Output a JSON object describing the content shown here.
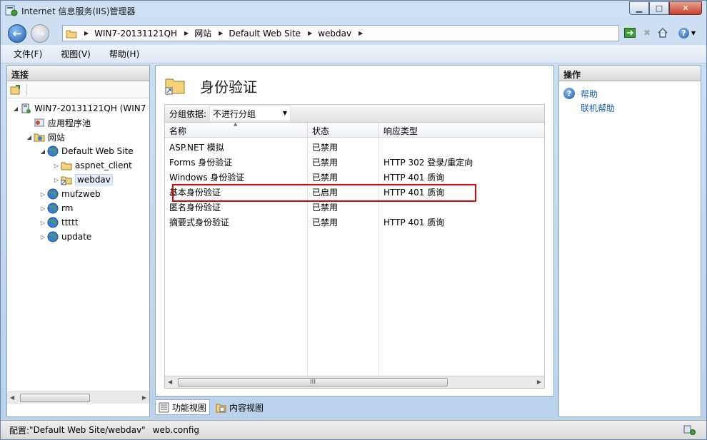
{
  "window": {
    "title": "Internet 信息服务(IIS)管理器",
    "controls": {
      "minimize": "▁",
      "maximize": "□",
      "close": "✕"
    }
  },
  "address": {
    "crumbs": [
      "WIN7-20131121QH",
      "网站",
      "Default Web Site",
      "webdav"
    ]
  },
  "menu": [
    "文件(F)",
    "视图(V)",
    "帮助(H)"
  ],
  "connections": {
    "header": "连接",
    "tree": [
      {
        "label": "WIN7-20131121QH (WIN7",
        "icon": "server-icon",
        "expander": "◢"
      },
      {
        "label": "应用程序池",
        "icon": "app-pool-icon",
        "expander": ""
      },
      {
        "label": "网站",
        "icon": "sites-folder-icon",
        "expander": "◢"
      },
      {
        "label": "Default Web Site",
        "icon": "globe-icon",
        "expander": "◢"
      },
      {
        "label": "aspnet_client",
        "icon": "folder-icon",
        "expander": "▷"
      },
      {
        "label": "webdav",
        "icon": "virtual-folder-icon",
        "expander": "▷",
        "selected": true
      },
      {
        "label": "mufzweb",
        "icon": "globe-icon",
        "expander": "▷"
      },
      {
        "label": "rm",
        "icon": "globe-icon",
        "expander": "▷"
      },
      {
        "label": "ttttt",
        "icon": "globe-icon",
        "expander": "▷"
      },
      {
        "label": "update",
        "icon": "globe-icon",
        "expander": "▷"
      }
    ]
  },
  "feature": {
    "title": "身份验证",
    "group_by_label": "分组依据:",
    "group_by_value": "不进行分组",
    "columns": [
      "名称",
      "状态",
      "响应类型"
    ],
    "rows": [
      {
        "name": "ASP.NET 模拟",
        "status": "已禁用",
        "response": ""
      },
      {
        "name": "Forms 身份验证",
        "status": "已禁用",
        "response": "HTTP 302 登录/重定向"
      },
      {
        "name": "Windows 身份验证",
        "status": "已禁用",
        "response": "HTTP 401 质询"
      },
      {
        "name": "基本身份验证",
        "status": "已启用",
        "response": "HTTP 401 质询"
      },
      {
        "name": "匿名身份验证",
        "status": "已禁用",
        "response": ""
      },
      {
        "name": "摘要式身份验证",
        "status": "已禁用",
        "response": "HTTP 401 质询"
      }
    ],
    "highlight_color": "#e00000"
  },
  "actions": {
    "header": "操作",
    "items": [
      "帮助",
      "联机帮助"
    ]
  },
  "view_tabs": {
    "features": "功能视图",
    "content": "内容视图"
  },
  "status": {
    "label": "配置:",
    "path": "\"Default Web Site/webdav\"",
    "file": "web.config"
  },
  "scroll_glyph": "III"
}
